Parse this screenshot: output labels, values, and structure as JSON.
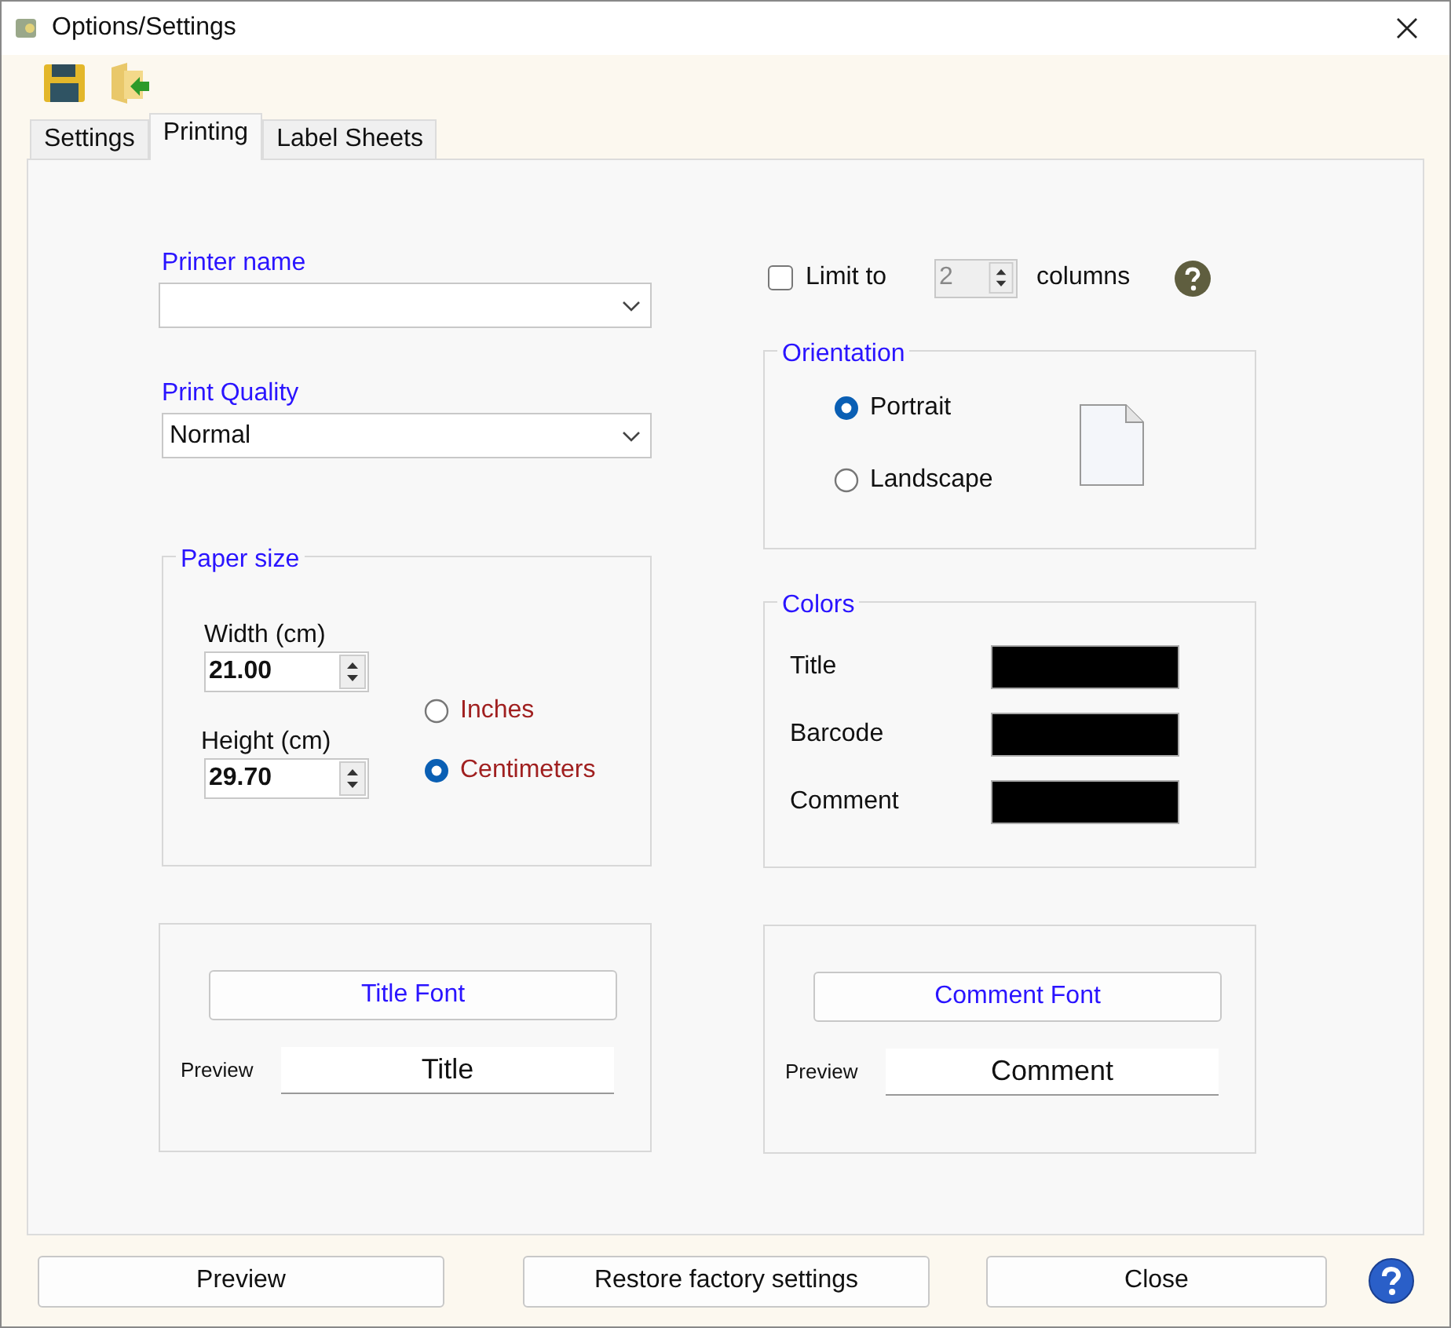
{
  "window": {
    "title": "Options/Settings"
  },
  "tabs": [
    {
      "label": "Settings",
      "selected": false
    },
    {
      "label": "Printing",
      "selected": true
    },
    {
      "label": "Label Sheets",
      "selected": false
    }
  ],
  "printer_name": {
    "label": "Printer name"
  },
  "print_quality": {
    "label": "Print Quality",
    "value": "Normal"
  },
  "paper_size": {
    "title": "Paper size",
    "fields": [
      {
        "label": "Width (cm)",
        "value": "21.00"
      },
      {
        "label": "Height (cm)",
        "value": "29.70"
      }
    ],
    "units": [
      {
        "label": "Inches",
        "selected": false
      },
      {
        "label": "Centimeters",
        "selected": true
      }
    ]
  },
  "limit": {
    "label": "Limit to",
    "checked": false,
    "value": "2",
    "disabled": true,
    "suffix": "columns"
  },
  "orientation": {
    "title": "Orientation",
    "options": [
      {
        "label": "Portrait",
        "selected": true
      },
      {
        "label": "Landscape",
        "selected": false
      }
    ]
  },
  "colors": {
    "title": "Colors",
    "items": [
      {
        "label": "Title",
        "color": "#000000"
      },
      {
        "label": "Barcode",
        "color": "#000000"
      },
      {
        "label": "Comment",
        "color": "#000000"
      }
    ]
  },
  "fonts": [
    {
      "button": "Title Font",
      "preview_label": "Preview",
      "preview": "Title"
    },
    {
      "button": "Comment Font",
      "preview_label": "Preview",
      "preview": "Comment"
    }
  ],
  "buttons": [
    "Preview",
    "Restore factory settings",
    "Close"
  ]
}
